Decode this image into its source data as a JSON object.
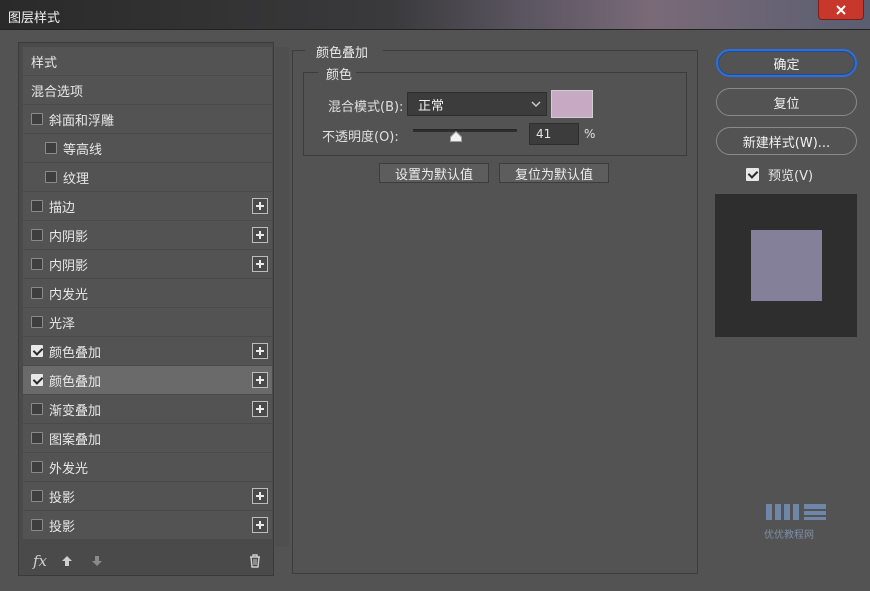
{
  "window": {
    "title": "图层样式"
  },
  "styles_list": {
    "items": [
      {
        "label": "样式",
        "checkbox": false,
        "checked": false,
        "indent": 0,
        "plus": false,
        "selected": false
      },
      {
        "label": "混合选项",
        "checkbox": false,
        "checked": false,
        "indent": 0,
        "plus": false,
        "selected": false
      },
      {
        "label": "斜面和浮雕",
        "checkbox": true,
        "checked": false,
        "indent": 0,
        "plus": false,
        "selected": false
      },
      {
        "label": "等高线",
        "checkbox": true,
        "checked": false,
        "indent": 1,
        "plus": false,
        "selected": false
      },
      {
        "label": "纹理",
        "checkbox": true,
        "checked": false,
        "indent": 1,
        "plus": false,
        "selected": false
      },
      {
        "label": "描边",
        "checkbox": true,
        "checked": false,
        "indent": 0,
        "plus": true,
        "selected": false
      },
      {
        "label": "内阴影",
        "checkbox": true,
        "checked": false,
        "indent": 0,
        "plus": true,
        "selected": false
      },
      {
        "label": "内阴影",
        "checkbox": true,
        "checked": false,
        "indent": 0,
        "plus": true,
        "selected": false
      },
      {
        "label": "内发光",
        "checkbox": true,
        "checked": false,
        "indent": 0,
        "plus": false,
        "selected": false
      },
      {
        "label": "光泽",
        "checkbox": true,
        "checked": false,
        "indent": 0,
        "plus": false,
        "selected": false
      },
      {
        "label": "颜色叠加",
        "checkbox": true,
        "checked": true,
        "indent": 0,
        "plus": true,
        "selected": false
      },
      {
        "label": "颜色叠加",
        "checkbox": true,
        "checked": true,
        "indent": 0,
        "plus": true,
        "selected": true
      },
      {
        "label": "渐变叠加",
        "checkbox": true,
        "checked": false,
        "indent": 0,
        "plus": true,
        "selected": false
      },
      {
        "label": "图案叠加",
        "checkbox": true,
        "checked": false,
        "indent": 0,
        "plus": false,
        "selected": false
      },
      {
        "label": "外发光",
        "checkbox": true,
        "checked": false,
        "indent": 0,
        "plus": false,
        "selected": false
      },
      {
        "label": "投影",
        "checkbox": true,
        "checked": false,
        "indent": 0,
        "plus": true,
        "selected": false
      },
      {
        "label": "投影",
        "checkbox": true,
        "checked": false,
        "indent": 0,
        "plus": true,
        "selected": false
      }
    ]
  },
  "toolbar": {
    "fx_label": "fx",
    "icons": [
      "fx-icon",
      "arrow-up-icon",
      "arrow-down-icon",
      "trash-icon"
    ]
  },
  "color_overlay": {
    "section_title": "颜色叠加",
    "group_title": "颜色",
    "blend_mode_label": "混合模式(B):",
    "blend_mode_value": "正常",
    "overlay_color": "#c7a9c4",
    "opacity_label": "不透明度(O):",
    "opacity_value": "41",
    "opacity_fraction": 0.41,
    "opacity_unit": "%",
    "set_default_label": "设置为默认值",
    "reset_default_label": "复位为默认值"
  },
  "actions": {
    "ok_label": "确定",
    "reset_label": "复位",
    "new_style_label": "新建样式(W)...",
    "preview_label": "预览(V)",
    "preview_checked": true
  },
  "preview": {
    "background": "#2e2e2e",
    "swatch_color": "#85809a"
  },
  "colors": {
    "accent": "#2f6fd6",
    "panel": "#535353",
    "close": "#c7372c"
  },
  "watermark": {
    "text": "优优教程网"
  }
}
